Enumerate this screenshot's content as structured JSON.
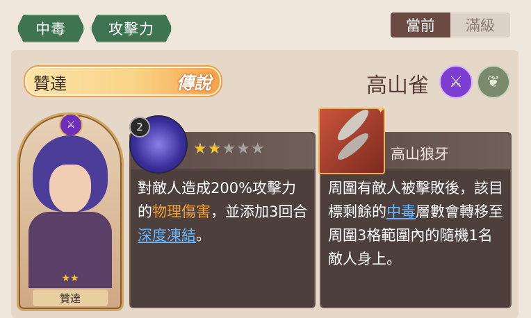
{
  "tags": [
    "中毒",
    "攻擊力"
  ],
  "toggle": {
    "current": "當前",
    "max": "滿級"
  },
  "character": {
    "name": "贊達",
    "rarity": "傳說",
    "stars": "★★",
    "label": "贊達"
  },
  "weapon": {
    "name": "高山雀",
    "item_name": "高山狼牙"
  },
  "skill": {
    "level": "2",
    "text_parts": [
      "對敵人造成200%攻擊力的",
      "物理傷害",
      "，並添加3回合",
      "深度凍結",
      "。"
    ],
    "stars_on": "★★",
    "stars_off": "★★★"
  },
  "weapon_effect": {
    "text_parts": [
      "周圍有敵人被擊敗後，該目標剩餘的",
      "中毒",
      "層數會轉移至周圍3格範圍內的隨機1名敵人身上。"
    ]
  },
  "icons": {
    "class_icon": "crossed-swords-icon",
    "element_icon": "leaf-icon",
    "weapon_sparkle": "sparkle-icon",
    "char_badge": "crossed-swords-icon"
  },
  "colors": {
    "tag_bg": "#3f7452",
    "toggle_active": "#6a4a43",
    "highlight_orange": "#f3a33b",
    "highlight_blue": "#6ab6ff"
  }
}
